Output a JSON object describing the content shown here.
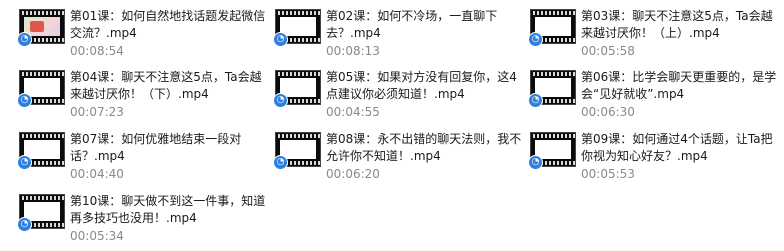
{
  "files": [
    {
      "title": "第01课：如何自然地找话题发起微信交流？.mp4",
      "duration": "00:08:54",
      "thumb": "image"
    },
    {
      "title": "第02课：如何不冷场，一直聊下去？.mp4",
      "duration": "00:08:13",
      "thumb": "blank"
    },
    {
      "title": "第03课：聊天不注意这5点，Ta会越来越讨厌你！（上）.mp4",
      "duration": "00:05:58",
      "thumb": "blank"
    },
    {
      "title": "第04课：聊天不注意这5点，Ta会越来越讨厌你！（下）.mp4",
      "duration": "00:07:23",
      "thumb": "blank"
    },
    {
      "title": "第05课：如果对方没有回复你，这4点建议你必须知道！.mp4",
      "duration": "00:04:55",
      "thumb": "blank"
    },
    {
      "title": "第06课：比学会聊天更重要的，是学会“见好就收”.mp4",
      "duration": "00:06:30",
      "thumb": "blank"
    },
    {
      "title": "第07课：如何优雅地结束一段对话？.mp4",
      "duration": "00:04:40",
      "thumb": "blank"
    },
    {
      "title": "第08课：永不出错的聊天法则，我不允许你不知道！.mp4",
      "duration": "00:06:20",
      "thumb": "blank"
    },
    {
      "title": "第09课：如何通过4个话题，让Ta把你视为知心好友？.mp4",
      "duration": "00:05:53",
      "thumb": "blank"
    },
    {
      "title": "第10课：聊天做不到这一件事，知道再多技巧也没用！.mp4",
      "duration": "00:05:34",
      "thumb": "blank"
    }
  ],
  "icons": {
    "thumbnail": "video-file-icon",
    "badge": "play-overlay-icon"
  },
  "colors": {
    "duration": "#8a8a8a",
    "badge": "#2f7fe0",
    "title": "#1a1a1a"
  }
}
